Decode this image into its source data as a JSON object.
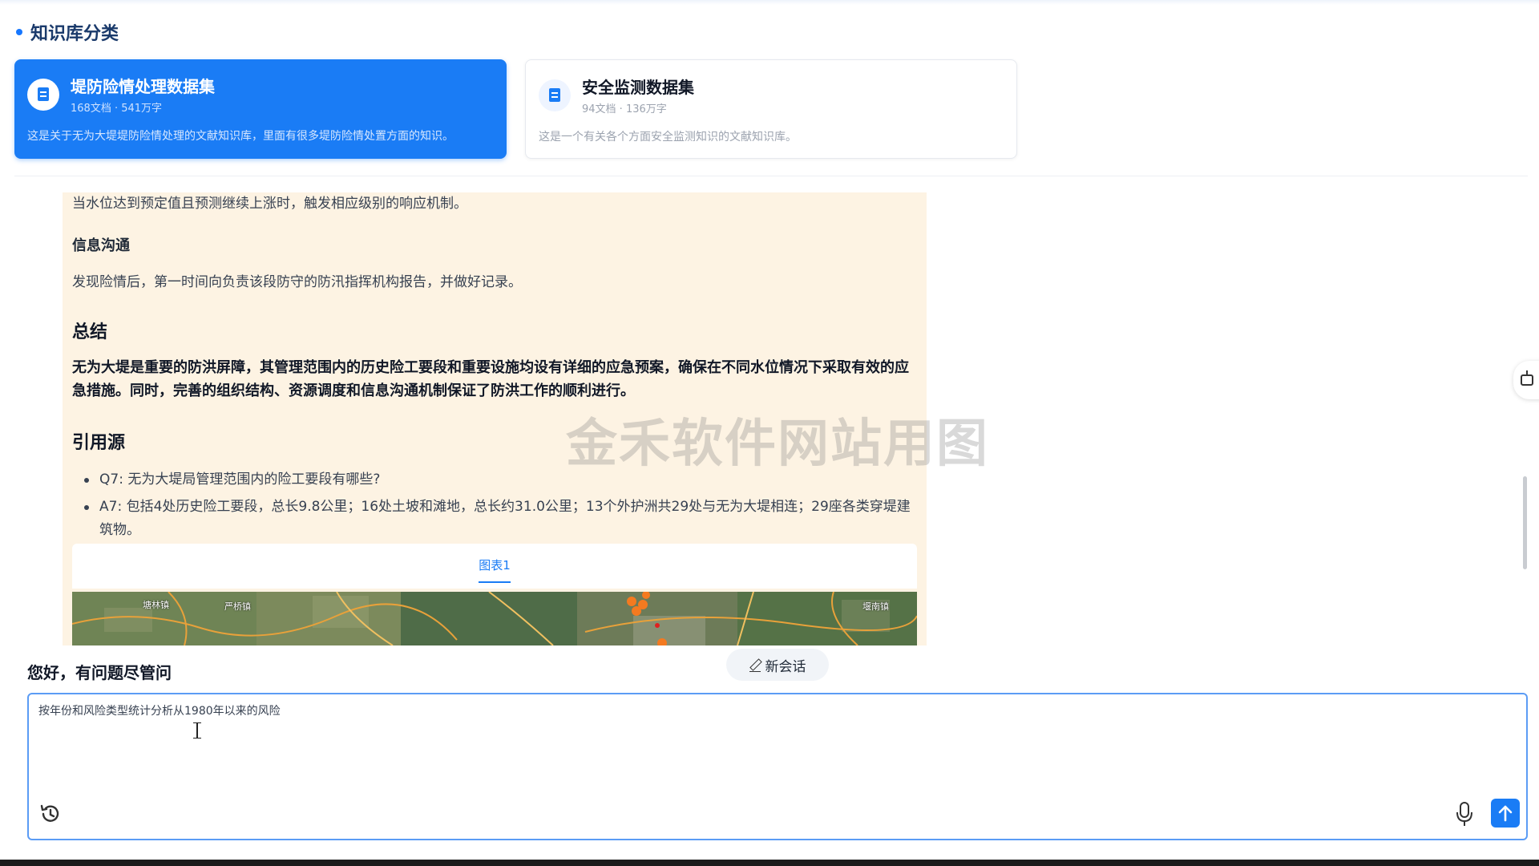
{
  "knowledge_base": {
    "title": "知识库分类",
    "cards": [
      {
        "name": "堤防险情处理数据集",
        "meta": "168文档 · 541万字",
        "description": "这是关于无为大堤堤防险情处理的文献知识库，里面有很多堤防险情处置方面的知识。",
        "active": true
      },
      {
        "name": "安全监测数据集",
        "meta": "94文档 · 136万字",
        "description": "这是一个有关各个方面安全监测知识的文献知识库。",
        "active": false
      }
    ]
  },
  "answer": {
    "p_trigger": "当水位达到预定值且预测继续上涨时，触发相应级别的响应机制。",
    "h_info": "信息沟通",
    "p_info": "发现险情后，第一时间向负责该段防守的防汛指挥机构报告，并做好记录。",
    "h_summary": "总结",
    "summary": "无为大堤是重要的防洪屏障，其管理范围内的历史险工要段和重要设施均设有详细的应急预案，确保在不同水位情况下采取有效的应急措施。同时，完善的组织结构、资源调度和信息沟通机制保证了防洪工作的顺利进行。",
    "h_refs": "引用源",
    "refs": [
      "Q7: 无为大堤局管理范围内的险工要段有哪些?",
      "A7: 包括4处历史险工要段，总长9.8公里；16处土坡和滩地，总长约31.0公里；13个外护洲共29处与无为大堤相连；29座各类穿堤建筑物。"
    ],
    "chart_tab": "图表1",
    "map_labels": [
      "塘林镇",
      "严桥镇",
      "堰南镇"
    ]
  },
  "watermark": "金禾软件网站用图",
  "chat": {
    "greeting": "您好，有问题尽管问",
    "new_chat": "新会话",
    "input_value": "按年份和风险类型统计分析从1980年以来的风险"
  },
  "icons": {
    "history": "history-icon",
    "mic": "microphone-icon",
    "send": "send-arrow-icon",
    "robot": "robot-icon",
    "document": "document-icon",
    "pen": "pen-icon"
  },
  "colors": {
    "accent": "#1a7cf5",
    "answer_bg": "#fdf3e3",
    "title": "#1a3a6b"
  }
}
